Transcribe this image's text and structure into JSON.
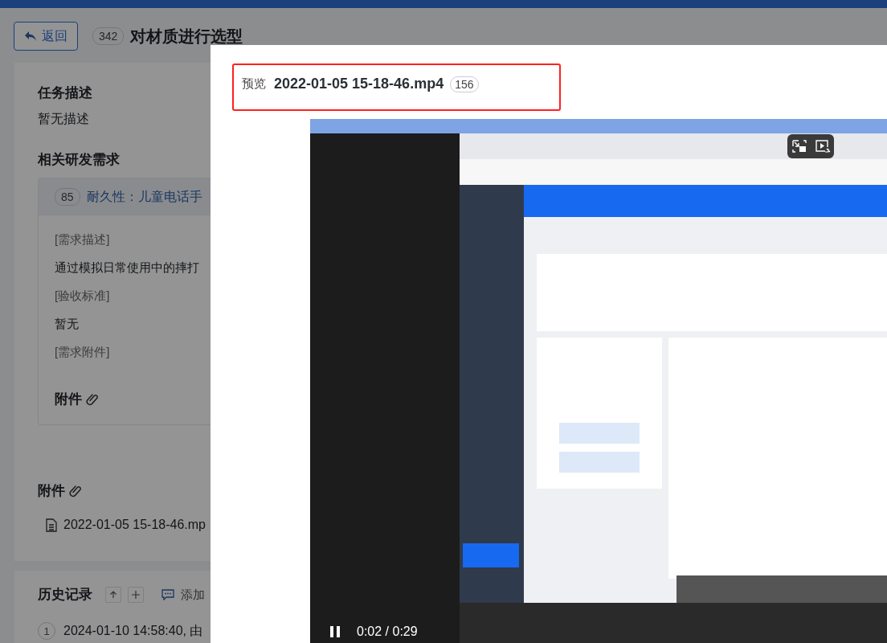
{
  "header": {
    "back_button": "返回",
    "task_id": "342",
    "task_title": "对材质进行选型"
  },
  "task_description": {
    "heading": "任务描述",
    "text": "暂无描述"
  },
  "related_requirements": {
    "heading": "相关研发需求",
    "item": {
      "id": "85",
      "title": "耐久性：儿童电话手"
    },
    "sections": [
      {
        "kind": "label",
        "text": "[需求描述]"
      },
      {
        "kind": "text",
        "text": "通过模拟日常使用中的摔打"
      },
      {
        "kind": "label",
        "text": "[验收标准]"
      },
      {
        "kind": "text",
        "text": "暂无"
      },
      {
        "kind": "label",
        "text": "[需求附件]"
      }
    ],
    "attachments_heading": "附件"
  },
  "attachments": {
    "heading": "附件",
    "files": [
      "2022-01-05 15-18-46.mp"
    ]
  },
  "history": {
    "heading": "历史记录",
    "add_comment": "添加",
    "entries": [
      {
        "index": "1",
        "text": "2024-01-10 14:58:40, 由"
      }
    ]
  },
  "preview": {
    "label": "预览",
    "file_name": "2022-01-05 15-18-46.mp4",
    "size": "156",
    "video": {
      "kind": "picture",
      "playing": true,
      "time": "0:02 / 0:29"
    }
  }
}
